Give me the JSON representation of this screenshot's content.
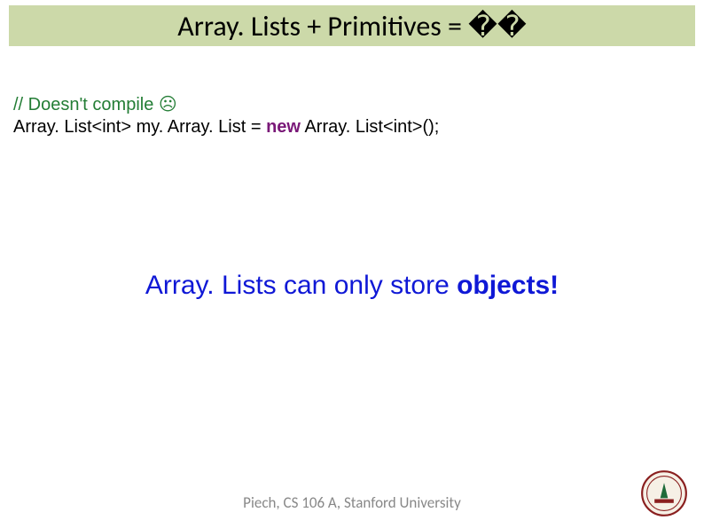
{
  "title": "Array. Lists + Primitives = ��",
  "code": {
    "comment": "// Doesn't compile ☹",
    "line_pre": "Array. List<int> my. Array. List = ",
    "kw": "new",
    "line_post": " Array. List<int>();"
  },
  "main": {
    "pre": "Array. Lists can only store ",
    "bold": "objects!"
  },
  "footer": "Piech, CS 106 A, Stanford University"
}
